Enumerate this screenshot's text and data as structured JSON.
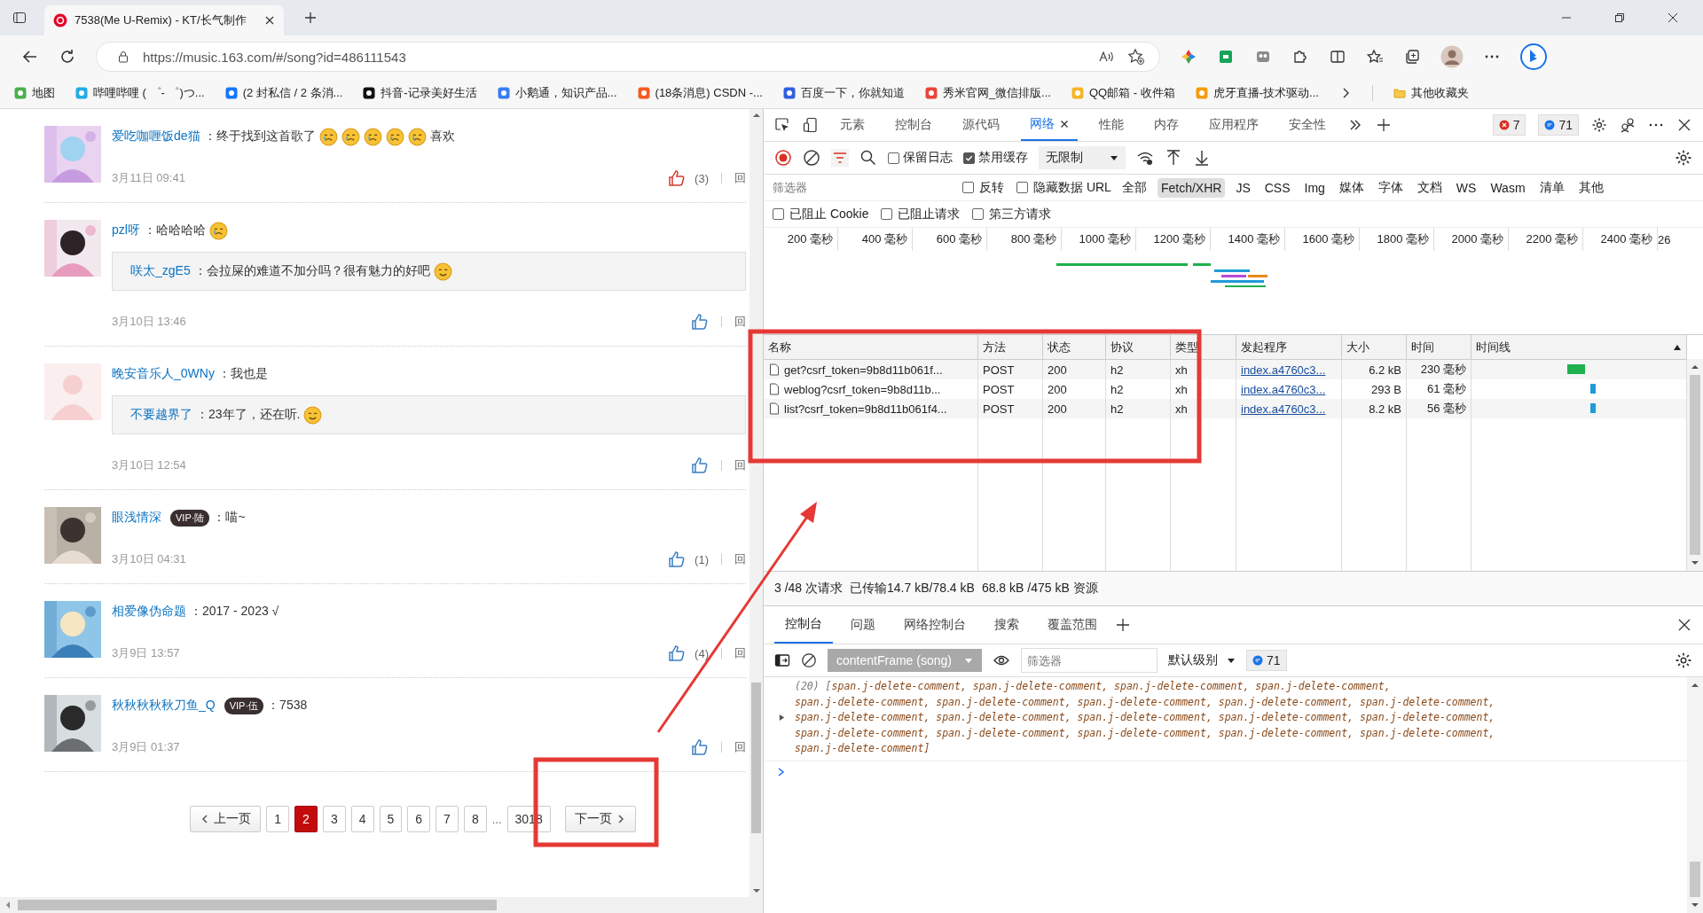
{
  "browser": {
    "tab": {
      "title": "7538(Me U-Remix) - KT/长气制作"
    },
    "address": "https://music.163.com/#/song?id=486111543",
    "bookmarks": [
      {
        "label": "地图"
      },
      {
        "label": "哔哩哔哩 ( ゜- ゜)つ..."
      },
      {
        "label": "(2 封私信 / 2 条消..."
      },
      {
        "label": "抖音-记录美好生活"
      },
      {
        "label": "小鹅通，知识产品..."
      },
      {
        "label": "(18条消息) CSDN -..."
      },
      {
        "label": "百度一下，你就知道"
      },
      {
        "label": "秀米官网_微信排版..."
      },
      {
        "label": "QQ邮箱 - 收件箱"
      },
      {
        "label": "虎牙直播-技术驱动..."
      }
    ],
    "other_bookmarks": "其他收藏夹"
  },
  "comments": [
    {
      "user": "爱吃咖喱饭de猫",
      "avatar": {
        "kind": "picture"
      },
      "parts": [
        {
          "kind": "text",
          "text": "：终于找到这首歌了"
        },
        {
          "kind": "emoji"
        },
        {
          "kind": "emoji"
        },
        {
          "kind": "emoji"
        },
        {
          "kind": "emoji"
        },
        {
          "kind": "emoji"
        },
        {
          "kind": "text",
          "text": "喜欢"
        }
      ],
      "time": "3月11日 09:41",
      "likes": "(3)",
      "liked": true,
      "reply_label": "回"
    },
    {
      "user": "pzl呀",
      "avatar": {
        "kind": "picture"
      },
      "parts": [
        {
          "kind": "text",
          "text": "：哈哈哈哈"
        },
        {
          "kind": "emoji"
        }
      ],
      "reply": {
        "user": "咲太_zgE5",
        "parts": [
          {
            "kind": "text",
            "text": "：会拉屎的难道不加分吗？很有魅力的好吧"
          },
          {
            "kind": "emoji"
          }
        ]
      },
      "time": "3月10日 13:46",
      "liked": false,
      "reply_label": "回"
    },
    {
      "user": "晚安音乐人_0WNy",
      "avatar": {
        "kind": "default"
      },
      "parts": [
        {
          "kind": "text",
          "text": "：我也是"
        }
      ],
      "reply": {
        "user": "不要越界了",
        "parts": [
          {
            "kind": "text",
            "text": "：23年了，还在听."
          },
          {
            "kind": "emoji"
          }
        ]
      },
      "time": "3月10日 12:54",
      "liked": false,
      "reply_label": "回"
    },
    {
      "user": "眼浅情深",
      "badge": "VIP·陆",
      "avatar": {
        "kind": "picture"
      },
      "parts": [
        {
          "kind": "text",
          "text": "：喵~"
        }
      ],
      "time": "3月10日 04:31",
      "likes": "(1)",
      "liked": false,
      "reply_label": "回"
    },
    {
      "user": "相爱像伪命题",
      "avatar": {
        "kind": "picture"
      },
      "parts": [
        {
          "kind": "text",
          "text": "：2017  - 2023 √"
        }
      ],
      "time": "3月9日 13:57",
      "likes": "(4)",
      "liked": false,
      "reply_label": "回"
    },
    {
      "user": "秋秋秋秋秋刀鱼_Q",
      "badge": "VIP·伍",
      "avatar": {
        "kind": "picture"
      },
      "parts": [
        {
          "kind": "text",
          "text": "：7538"
        }
      ],
      "time": "3月9日 01:37",
      "liked": false,
      "reply_label": "回"
    }
  ],
  "pagination": {
    "prev": "上一页",
    "pages": [
      {
        "label": "1",
        "selected": false
      },
      {
        "label": "2",
        "selected": true
      },
      {
        "label": "3",
        "selected": false
      },
      {
        "label": "4",
        "selected": false
      },
      {
        "label": "5",
        "selected": false
      },
      {
        "label": "6",
        "selected": false
      },
      {
        "label": "7",
        "selected": false
      },
      {
        "label": "8",
        "selected": false
      }
    ],
    "ellipsis": "...",
    "last": "3018",
    "next": "下一页"
  },
  "devtools": {
    "tabs": [
      {
        "label": "元素",
        "selected": false,
        "closable": false
      },
      {
        "label": "控制台",
        "selected": false,
        "closable": false
      },
      {
        "label": "源代码",
        "selected": false,
        "closable": false
      },
      {
        "label": "网络",
        "selected": true,
        "closable": true
      },
      {
        "label": "性能",
        "selected": false,
        "closable": false
      },
      {
        "label": "内存",
        "selected": false,
        "closable": false
      },
      {
        "label": "应用程序",
        "selected": false,
        "closable": false
      },
      {
        "label": "安全性",
        "selected": false,
        "closable": false
      }
    ],
    "error_count": "7",
    "message_count": "71",
    "network": {
      "recording": true,
      "preserve_log": {
        "label": "保留日志",
        "checked": false
      },
      "disable_cache": {
        "label": "禁用缓存",
        "checked": true
      },
      "throttle": "无限制",
      "filter_placeholder": "筛选器",
      "invert": {
        "label": "反转",
        "checked": false
      },
      "hide_data_urls": {
        "label": "隐藏数据 URL",
        "checked": false
      },
      "types": [
        {
          "label": "全部",
          "selected": false
        },
        {
          "label": "Fetch/XHR",
          "selected": true
        },
        {
          "label": "JS",
          "selected": false
        },
        {
          "label": "CSS",
          "selected": false
        },
        {
          "label": "Img",
          "selected": false
        },
        {
          "label": "媒体",
          "selected": false
        },
        {
          "label": "字体",
          "selected": false
        },
        {
          "label": "文档",
          "selected": false
        },
        {
          "label": "WS",
          "selected": false
        },
        {
          "label": "Wasm",
          "selected": false
        },
        {
          "label": "清单",
          "selected": false
        },
        {
          "label": "其他",
          "selected": false
        }
      ],
      "blocked_options": [
        {
          "label": "已阻止 Cookie",
          "checked": false
        },
        {
          "label": "已阻止请求",
          "checked": false
        },
        {
          "label": "第三方请求",
          "checked": false
        }
      ],
      "overview_ticks": [
        "200 毫秒",
        "400 毫秒",
        "600 毫秒",
        "800 毫秒",
        "1000 毫秒",
        "1200 毫秒",
        "1400 毫秒",
        "1600 毫秒",
        "1800 毫秒",
        "2000 毫秒",
        "2200 毫秒",
        "2400 毫秒",
        "26"
      ],
      "columns": [
        "名称",
        "方法",
        "状态",
        "协议",
        "类型",
        "发起程序",
        "大小",
        "时间",
        "时间线"
      ],
      "requests": [
        {
          "name": "get?csrf_token=9b8d11b061f...",
          "method": "POST",
          "status": "200",
          "protocol": "h2",
          "type": "xh",
          "initiator": "index.a4760c3...",
          "size": "6.2 kB",
          "time": "230 毫秒"
        },
        {
          "name": "weblog?csrf_token=9b8d11b...",
          "method": "POST",
          "status": "200",
          "protocol": "h2",
          "type": "xh",
          "initiator": "index.a4760c3...",
          "size": "293 B",
          "time": "61 毫秒"
        },
        {
          "name": "list?csrf_token=9b8d11b061f4...",
          "method": "POST",
          "status": "200",
          "protocol": "h2",
          "type": "xh",
          "initiator": "index.a4760c3...",
          "size": "8.2 kB",
          "time": "56 毫秒"
        }
      ],
      "status": {
        "requests": "3 /48 次请求",
        "transferred": "已传输14.7 kB/78.4 kB",
        "resources": "68.8 kB /475 kB 资源"
      }
    },
    "drawer": {
      "tabs": [
        {
          "label": "控制台",
          "selected": true
        },
        {
          "label": "问题",
          "selected": false
        },
        {
          "label": "网络控制台",
          "selected": false
        },
        {
          "label": "搜索",
          "selected": false
        },
        {
          "label": "覆盖范围",
          "selected": false
        }
      ],
      "console": {
        "context": "contentFrame (song)",
        "filter_placeholder": "筛选器",
        "level": "默认级别",
        "message_count": "71",
        "output": {
          "prefix": "(20) [",
          "expanded": false,
          "lines": [
            "span.j-delete-comment, span.j-delete-comment, span.j-delete-comment, span.j-delete-comment,",
            "span.j-delete-comment, span.j-delete-comment, span.j-delete-comment, span.j-delete-comment, span.j-delete-comment,",
            "span.j-delete-comment, span.j-delete-comment, span.j-delete-comment, span.j-delete-comment, span.j-delete-comment,",
            "span.j-delete-comment, span.j-delete-comment, span.j-delete-comment, span.j-delete-comment, span.j-delete-comment,",
            "span.j-delete-comment]"
          ]
        }
      }
    }
  }
}
